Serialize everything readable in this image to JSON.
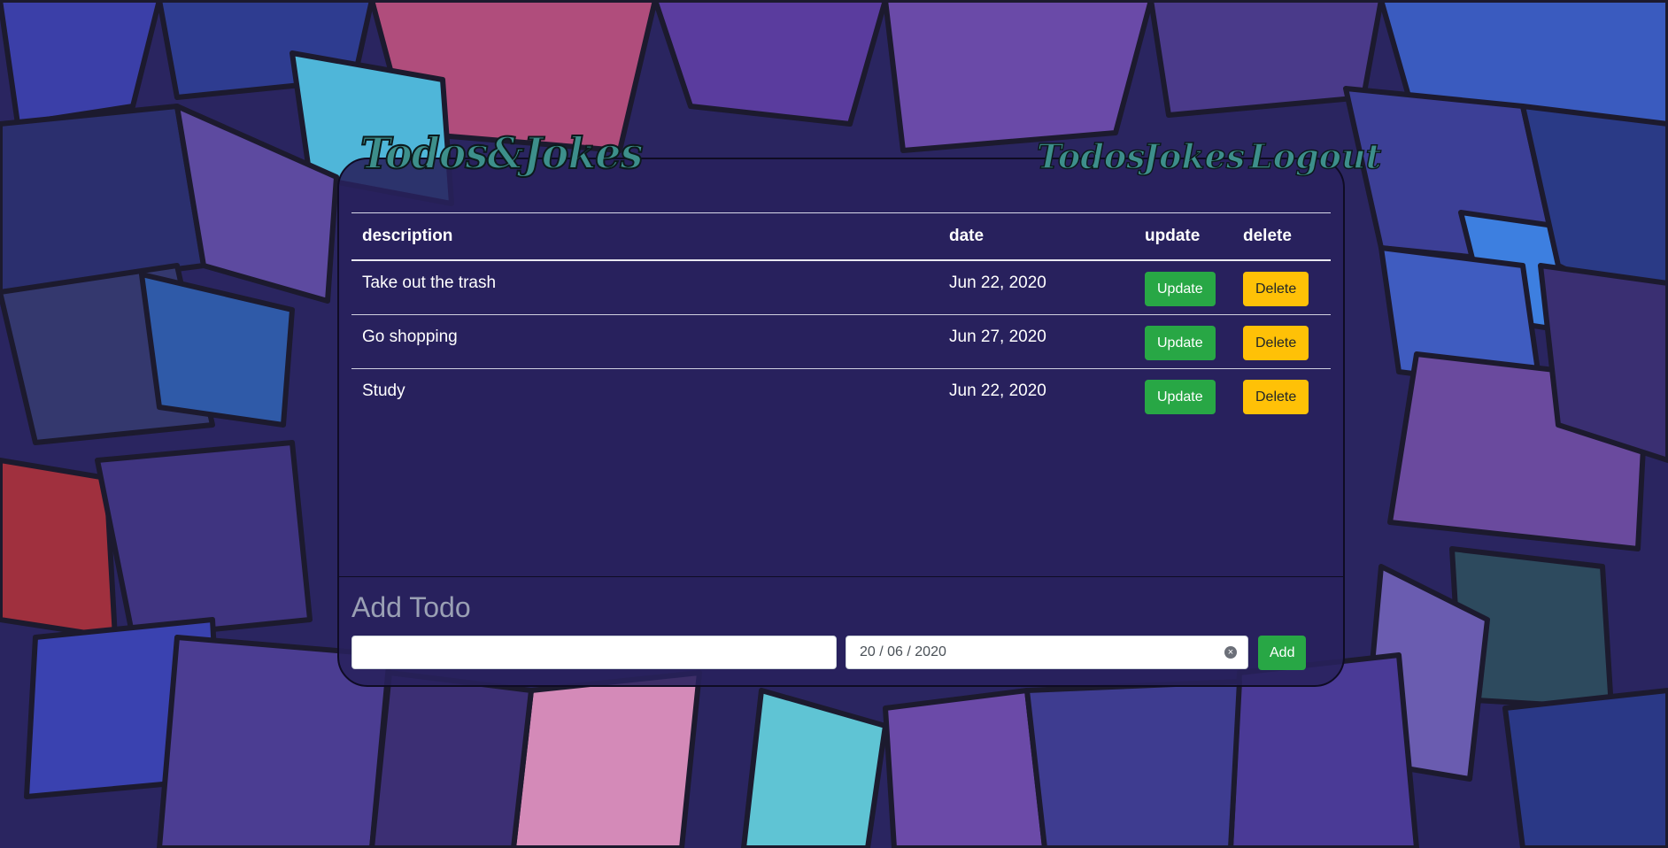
{
  "brand": {
    "title": "Todos&Jokes"
  },
  "nav": {
    "todos": "Todos",
    "jokes": "Jokes",
    "logout": "Logout"
  },
  "table": {
    "headers": {
      "description": "description",
      "date": "date",
      "update": "update",
      "delete": "delete"
    },
    "rows": [
      {
        "description": "Take out the trash",
        "date": "Jun 22, 2020",
        "update": "Update",
        "delete": "Delete"
      },
      {
        "description": "Go shopping",
        "date": "Jun 27, 2020",
        "update": "Update",
        "delete": "Delete"
      },
      {
        "description": "Study",
        "date": "Jun 22, 2020",
        "update": "Update",
        "delete": "Delete"
      }
    ]
  },
  "add_form": {
    "title": "Add Todo",
    "description_value": "",
    "date_value": "20 / 06 / 2020",
    "add_label": "Add"
  },
  "colors": {
    "update_button": "#28a745",
    "delete_button": "#ffc107",
    "brand_text": "#3d8f8b"
  }
}
